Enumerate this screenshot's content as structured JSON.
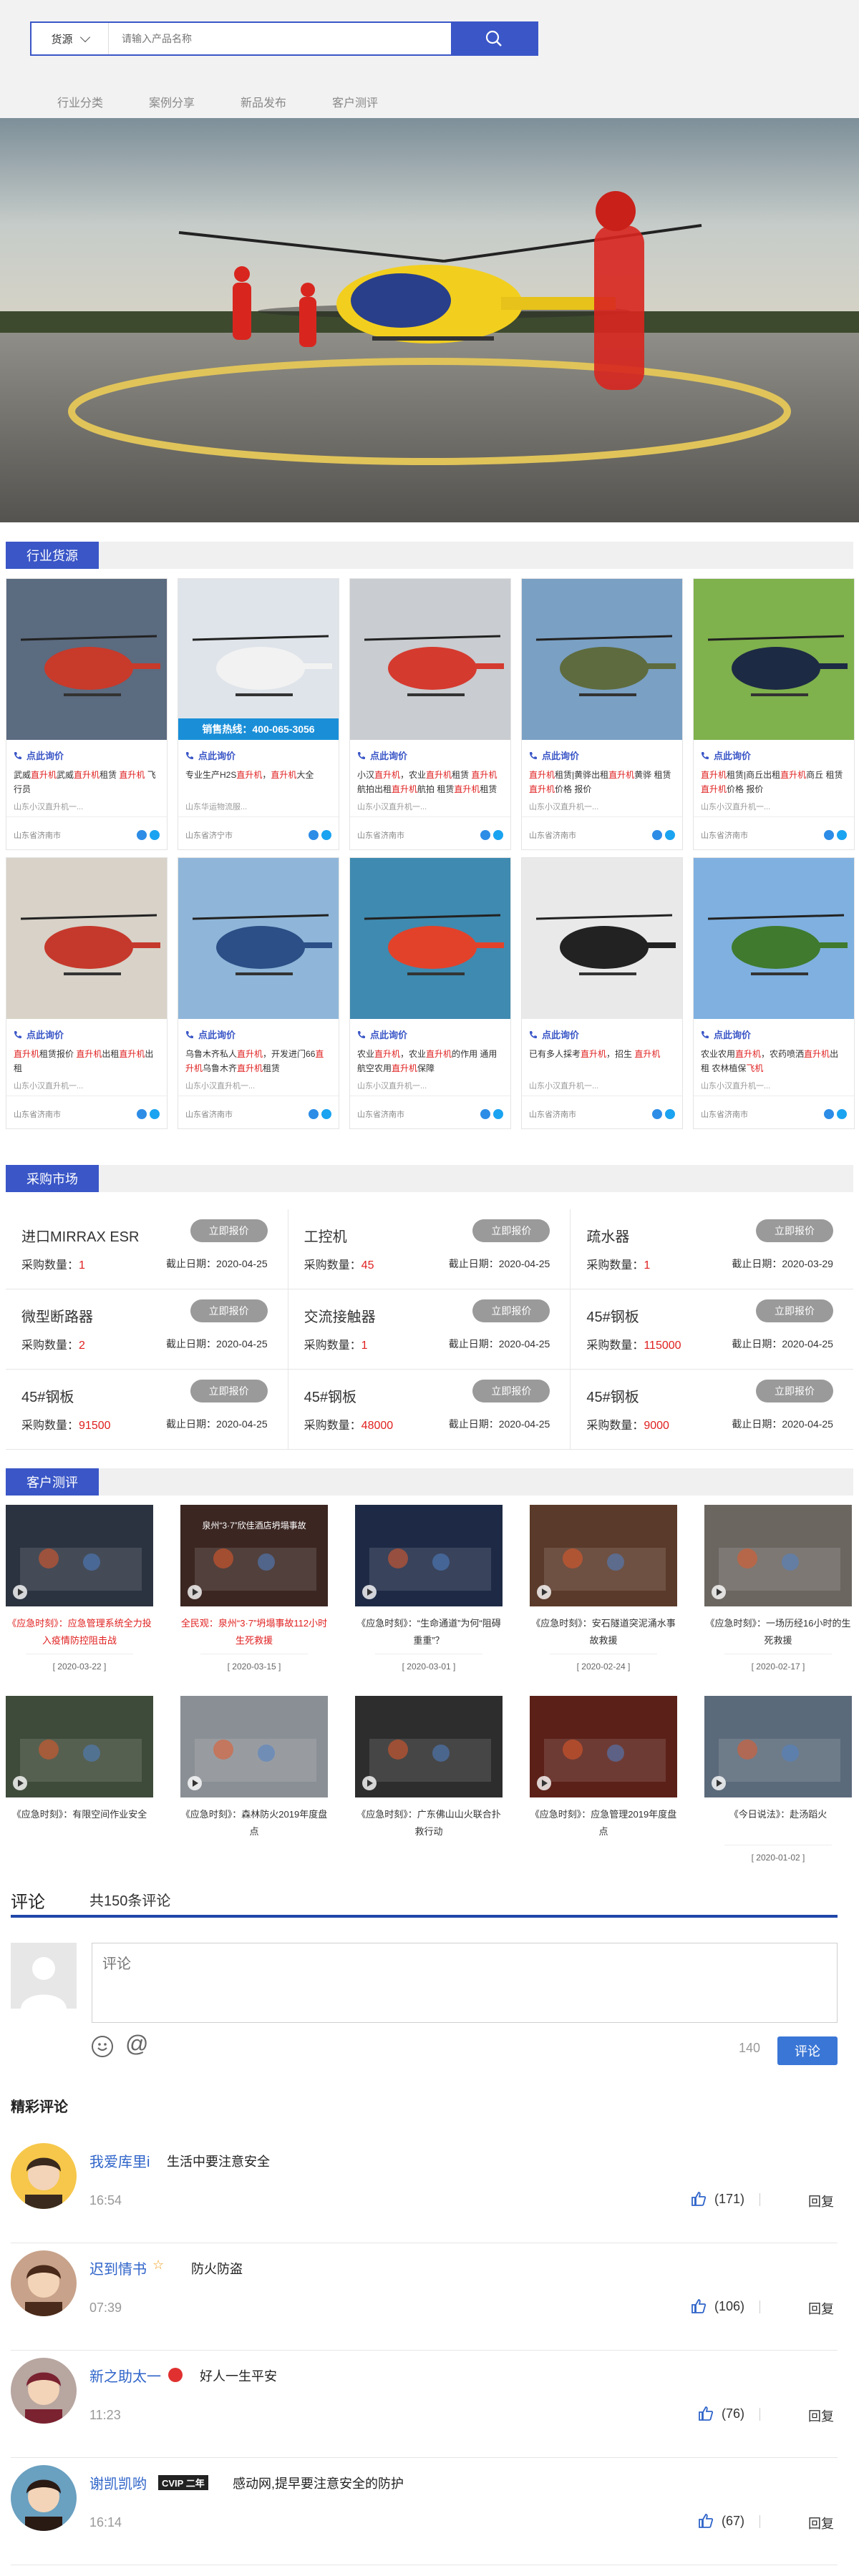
{
  "search": {
    "category": "货源",
    "placeholder": "请输入产品名称"
  },
  "nav": [
    "行业分类",
    "案例分享",
    "新品发布",
    "客户测评"
  ],
  "sections": {
    "supply": "行业货源",
    "market": "采购市场",
    "reviews": "客户测评"
  },
  "products": [
    {
      "ask": "点此询价",
      "desc": [
        [
          "武威",
          ""
        ],
        [
          "直升机",
          "hl"
        ],
        [
          "武威",
          ""
        ],
        [
          "直升机",
          "hl"
        ],
        [
          "租赁 ",
          ""
        ],
        [
          "直升机",
          "hl"
        ],
        [
          " 飞行员",
          ""
        ]
      ],
      "company": "山东小汉直升机一...",
      "region": "山东省济南市"
    },
    {
      "ask": "点此询价",
      "banner": "销售热线：400-065-3056",
      "desc": [
        [
          "专业生产H2S",
          ""
        ],
        [
          "直升机",
          "hl"
        ],
        [
          "，",
          ""
        ],
        [
          "直升机",
          "hl"
        ],
        [
          "大全",
          ""
        ]
      ],
      "company": "山东华运物流服...",
      "region": "山东省济宁市"
    },
    {
      "ask": "点此询价",
      "desc": [
        [
          "小汉",
          ""
        ],
        [
          "直升机",
          "hl"
        ],
        [
          "，农业",
          ""
        ],
        [
          "直升机",
          "hl"
        ],
        [
          "租赁 ",
          ""
        ],
        [
          "直升机",
          "hl"
        ],
        [
          "航拍出租",
          ""
        ],
        [
          "直升机",
          "hl"
        ],
        [
          "航拍 租赁",
          ""
        ],
        [
          "直升机",
          "hl"
        ],
        [
          "租赁",
          ""
        ]
      ],
      "company": "山东小汉直升机一...",
      "region": "山东省济南市"
    },
    {
      "ask": "点此询价",
      "desc": [
        [
          "直升机",
          "hl"
        ],
        [
          "租赁|黄骅出租",
          ""
        ],
        [
          "直升机",
          "hl"
        ],
        [
          "黄骅 租赁",
          ""
        ],
        [
          "直升机",
          "hl"
        ],
        [
          "价格 报价",
          ""
        ]
      ],
      "company": "山东小汉直升机一...",
      "region": "山东省济南市"
    },
    {
      "ask": "点此询价",
      "desc": [
        [
          "直升机",
          "hl"
        ],
        [
          "租赁|商丘出租",
          ""
        ],
        [
          "直升机",
          "hl"
        ],
        [
          "商丘 租赁",
          ""
        ],
        [
          "直升机",
          "hl"
        ],
        [
          "价格 报价",
          ""
        ]
      ],
      "company": "山东小汉直升机一...",
      "region": "山东省济南市"
    },
    {
      "ask": "点此询价",
      "desc": [
        [
          "直升机",
          "hl"
        ],
        [
          "租赁报价 ",
          ""
        ],
        [
          "直升机",
          "hl"
        ],
        [
          "出租",
          ""
        ],
        [
          "直升机",
          "hl"
        ],
        [
          "出租",
          ""
        ]
      ],
      "company": "山东小汉直升机一...",
      "region": "山东省济南市"
    },
    {
      "ask": "点此询价",
      "desc": [
        [
          "乌鲁木齐私人",
          ""
        ],
        [
          "直升机",
          "hl"
        ],
        [
          "，开发进门66",
          ""
        ],
        [
          "直升机",
          "hl"
        ],
        [
          "乌鲁木齐",
          ""
        ],
        [
          "直升机",
          "hl"
        ],
        [
          "租赁",
          ""
        ]
      ],
      "company": "山东小汉直升机一...",
      "region": "山东省济南市"
    },
    {
      "ask": "点此询价",
      "desc": [
        [
          "农业",
          ""
        ],
        [
          "直升机",
          "hl"
        ],
        [
          "，农业",
          ""
        ],
        [
          "直升机",
          "hl"
        ],
        [
          "的作用 通用航空农用",
          ""
        ],
        [
          "直升机",
          "hl"
        ],
        [
          "保障",
          ""
        ]
      ],
      "company": "山东小汉直升机一...",
      "region": "山东省济南市"
    },
    {
      "ask": "点此询价",
      "desc": [
        [
          "已有多人採考",
          ""
        ],
        [
          "直升机",
          "hl"
        ],
        [
          "，招生 ",
          ""
        ],
        [
          "直升机",
          "hl"
        ]
      ],
      "company": "山东小汉直升机一...",
      "region": "山东省济南市"
    },
    {
      "ask": "点此询价",
      "desc": [
        [
          "农业农用",
          ""
        ],
        [
          "直升机",
          "hl"
        ],
        [
          "，农药喷洒",
          ""
        ],
        [
          "直升机",
          "hl"
        ],
        [
          "出租 农林植保",
          ""
        ],
        [
          "飞机",
          "hl"
        ]
      ],
      "company": "山东小汉直升机一...",
      "region": "山东省济南市"
    }
  ],
  "market": {
    "quote_label": "立即报价",
    "qty_label": "采购数量：",
    "deadline_label": "截止日期：",
    "items": [
      {
        "name": "进口MIRRAX ESR",
        "qty": "1",
        "date": "2020-04-25"
      },
      {
        "name": "工控机",
        "qty": "45",
        "date": "2020-04-25"
      },
      {
        "name": "疏水器",
        "qty": "1",
        "date": "2020-03-29"
      },
      {
        "name": "微型断路器",
        "qty": "2",
        "date": "2020-04-25"
      },
      {
        "name": "交流接触器",
        "qty": "1",
        "date": "2020-04-25"
      },
      {
        "name": "45#钢板",
        "qty": "115000",
        "date": "2020-04-25"
      },
      {
        "name": "45#钢板",
        "qty": "91500",
        "date": "2020-04-25"
      },
      {
        "name": "45#钢板",
        "qty": "48000",
        "date": "2020-04-25"
      },
      {
        "name": "45#钢板",
        "qty": "9000",
        "date": "2020-04-25"
      }
    ]
  },
  "videos": [
    {
      "title": "《应急时刻》：应急管理系统全力投入疫情防控阻击战",
      "date": "[ 2020-03-22 ]",
      "red": true,
      "overlay": ""
    },
    {
      "title": "全民观：泉州“3·7”坍塌事故112小时生死救援",
      "date": "[ 2020-03-15 ]",
      "red": true,
      "overlay": "泉州“3·7”欣佳酒店坍塌事故"
    },
    {
      "title": "《应急时刻》：“生命通道”为何“阻碍重重”？",
      "date": "[ 2020-03-01 ]",
      "red": false,
      "overlay": ""
    },
    {
      "title": "《应急时刻》：安石隧道突泥涌水事故救援",
      "date": "[ 2020-02-24 ]",
      "red": false,
      "overlay": ""
    },
    {
      "title": "《应急时刻》：一场历经16小时的生死救援",
      "date": "[ 2020-02-17 ]",
      "red": false,
      "overlay": ""
    },
    {
      "title": "《应急时刻》：有限空间作业安全",
      "date": "",
      "red": false,
      "overlay": ""
    },
    {
      "title": "《应急时刻》：森林防火2019年度盘点",
      "date": "",
      "red": false,
      "overlay": ""
    },
    {
      "title": "《应急时刻》：广东佛山山火联合扑救行动",
      "date": "",
      "red": false,
      "overlay": ""
    },
    {
      "title": "《应急时刻》：应急管理2019年度盘点",
      "date": "",
      "red": false,
      "overlay": ""
    },
    {
      "title": "《今日说法》：赴汤蹈火",
      "date": "[ 2020-01-02 ]",
      "red": false,
      "overlay": ""
    }
  ],
  "comments_area": {
    "tab": "评论",
    "total": "共150条评论",
    "placeholder": "评论",
    "count": "140",
    "post": "评论",
    "featured": "精彩评论",
    "reply": "回复",
    "items": [
      {
        "name": "我爱库里i",
        "text": "生活中要注意安全",
        "time": "16:54",
        "likes": "(171)",
        "badge": ""
      },
      {
        "name": "迟到情书",
        "text": "防火防盗",
        "time": "07:39",
        "likes": "(106)",
        "badge": "star"
      },
      {
        "name": "新之助太一",
        "text": "好人一生平安",
        "time": "11:23",
        "likes": "(76)",
        "badge": "v"
      },
      {
        "name": "谢凯凯哟",
        "text": "感动网,提早要注意安全的防护",
        "time": "16:14",
        "likes": "(67)",
        "badge": "CVIP",
        "badge_year": "二年"
      }
    ]
  },
  "colors": {
    "brand": "#3a56c7",
    "price": "#e02020",
    "link": "#2f64c9"
  }
}
